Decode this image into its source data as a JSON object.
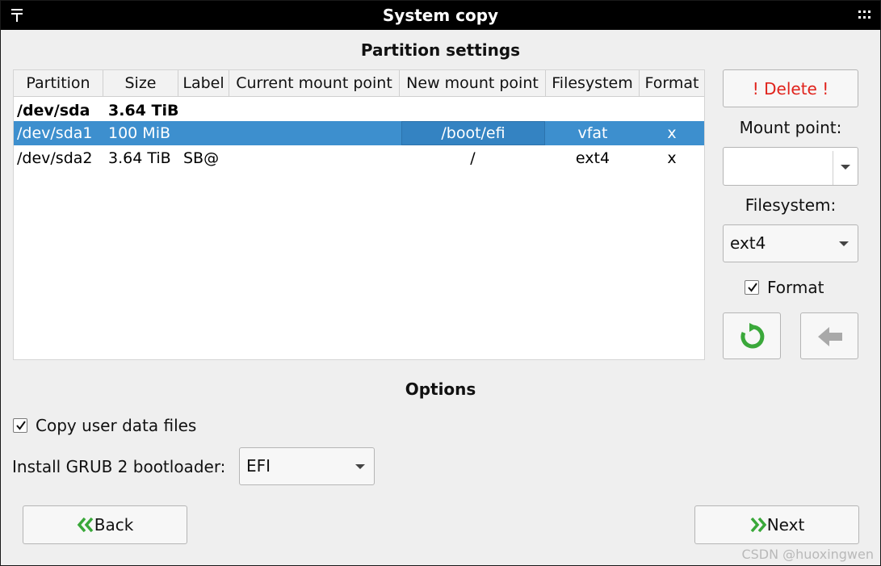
{
  "window": {
    "title": "System copy"
  },
  "partition_settings": {
    "title": "Partition settings",
    "columns": [
      "Partition",
      "Size",
      "Label",
      "Current mount point",
      "New mount point",
      "Filesystem",
      "Format"
    ],
    "rows": [
      {
        "partition": "/dev/sda",
        "size": "3.64 TiB",
        "label": "",
        "current_mount": "",
        "new_mount": "",
        "filesystem": "",
        "format": ""
      },
      {
        "partition": "/dev/sda1",
        "size": "100 MiB",
        "label": "",
        "current_mount": "",
        "new_mount": "/boot/efi",
        "filesystem": "vfat",
        "format": "x"
      },
      {
        "partition": "/dev/sda2",
        "size": "3.64 TiB",
        "label": "SB@",
        "current_mount": "",
        "new_mount": "/",
        "filesystem": "ext4",
        "format": "x"
      }
    ],
    "selected_row": 1
  },
  "side_panel": {
    "delete_label": "! Delete !",
    "mount_point_label": "Mount point:",
    "mount_point_value": "",
    "filesystem_label": "Filesystem:",
    "filesystem_value": "ext4",
    "format_label": "Format",
    "format_checked": true,
    "apply_icon": "green-refresh-icon",
    "revert_icon": "gray-left-arrow-icon"
  },
  "options": {
    "title": "Options",
    "copy_user_data_label": "Copy user data files",
    "copy_user_data_checked": true,
    "grub_label": "Install GRUB 2 bootloader:",
    "grub_value": "EFI"
  },
  "footer": {
    "back_label": "Back",
    "next_label": "Next"
  },
  "watermark": "CSDN @huoxingwen",
  "colors": {
    "selection": "#3d8fce",
    "delete_text": "#e0221b",
    "nav_icon_green": "#3aa83a"
  }
}
